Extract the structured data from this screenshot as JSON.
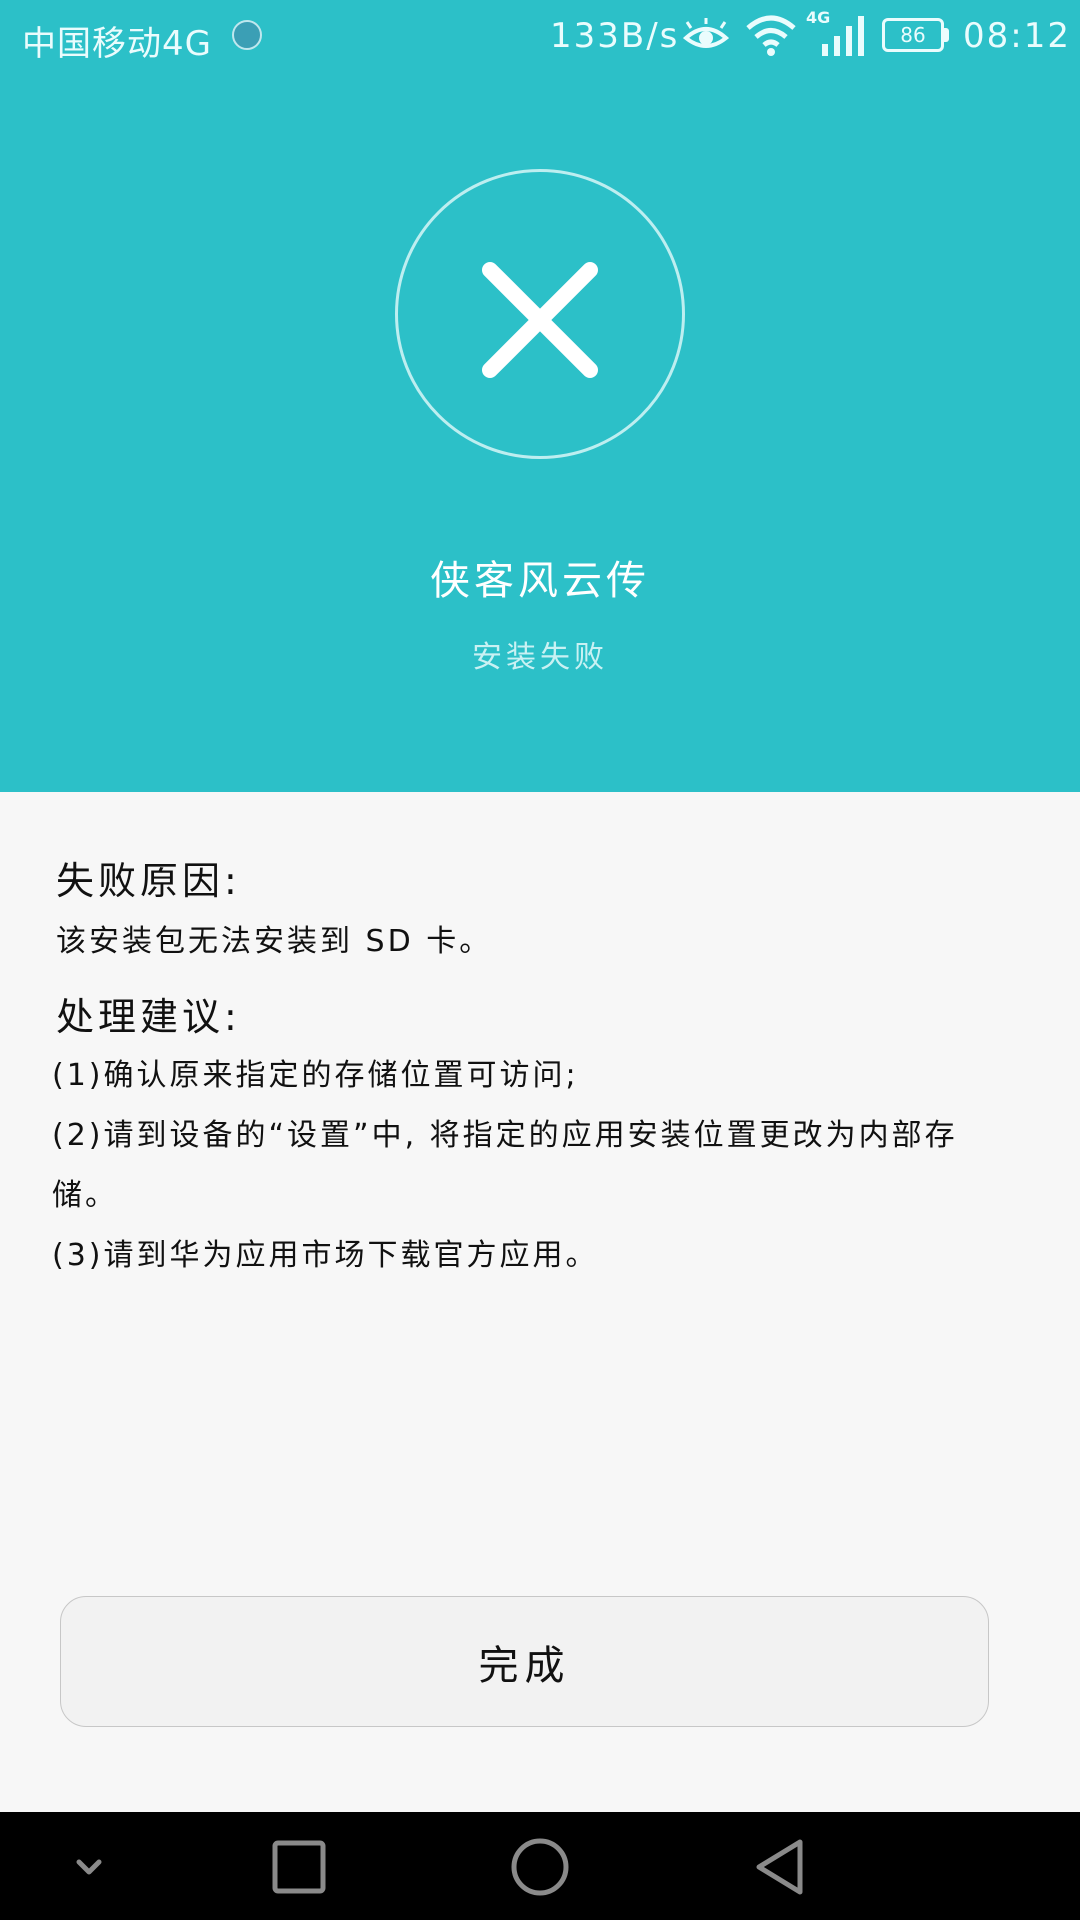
{
  "status_bar": {
    "carrier": "中国移动4G",
    "net_speed": "133B/s",
    "signal_tag": "4G",
    "battery": "86",
    "time": "08:12",
    "icons": [
      "globe-icon",
      "eye-icon",
      "wifi-icon",
      "signal-icon",
      "battery-icon"
    ]
  },
  "header": {
    "app_name": "侠客风云传",
    "install_status": "安装失败",
    "status_icon": "close-icon"
  },
  "failure": {
    "reason_title": "失败原因:",
    "reason_text": "该安装包无法安装到 SD 卡。"
  },
  "advice": {
    "title": "处理建议:",
    "items": [
      "(1)确认原来指定的存储位置可访问;",
      "(2)请到设备的“设置”中, 将指定的应用安装位置更改为内部存储。",
      "(3)请到华为应用市场下载官方应用。"
    ]
  },
  "actions": {
    "done_label": "完成"
  },
  "navbar": {
    "icons": [
      "chevron-down-icon",
      "recents-icon",
      "home-icon",
      "back-icon"
    ]
  },
  "colors": {
    "accent": "#2cc0c8",
    "background": "#f7f7f7",
    "navbar": "#000000"
  }
}
